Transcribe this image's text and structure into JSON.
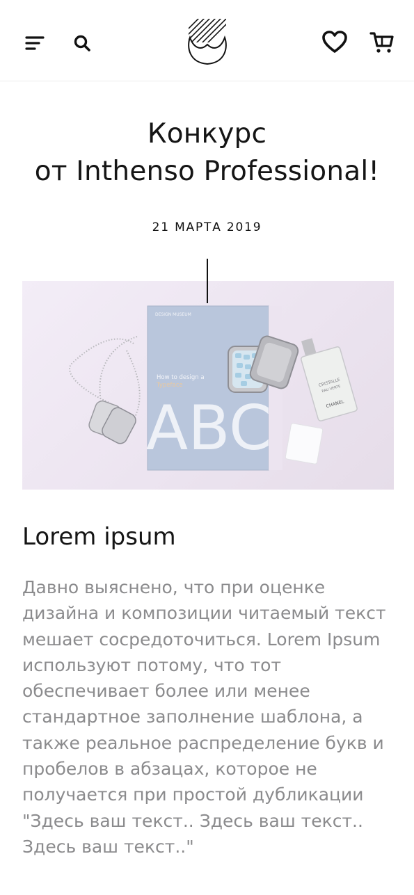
{
  "header": {
    "menu_icon": "menu-icon",
    "search_icon": "search-icon",
    "logo_icon": "brand-logo-icon",
    "favorites_icon": "heart-icon",
    "cart_icon": "cart-icon"
  },
  "article": {
    "title_line1": "Конкурс",
    "title_line2": "от Inthenso Professional!",
    "date": "21 МАРТА 2019",
    "image": {
      "book_publisher": "DESIGN MUSEUM",
      "book_title_line1": "How to design a",
      "book_title_line2": "Typeface",
      "book_cover_letters": "ABC",
      "perfume_label_line1": "CRISTALLE",
      "perfume_label_line2": "EAU VERTE",
      "perfume_brand": "CHANEL"
    },
    "heading": "Lorem ipsum",
    "body": "Давно выяснено, что при оценке дизайна и композиции читаемый текст мешает сосредоточиться. Lorem Ipsum используют потому, что тот обеспечивает более или менее стандартное заполнение шаблона, а также реальное распределение букв и пробелов в абзацах, которое не получается при простой дубликации \"Здесь ваш текст.. Здесь ваш текст.. Здесь ваш текст..\""
  },
  "colors": {
    "text_primary": "#151515",
    "text_secondary": "#8b8b8d",
    "image_background": "#ece4f0",
    "book_cover": "#b9c6dc"
  }
}
